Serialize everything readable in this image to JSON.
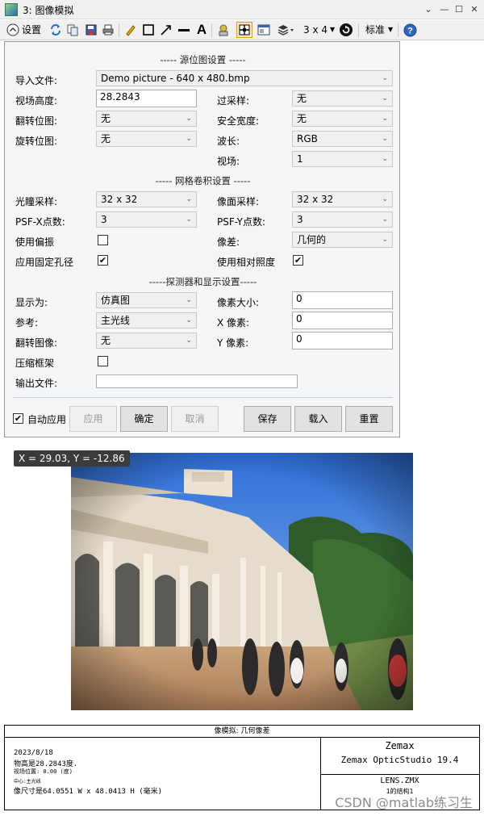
{
  "window": {
    "title": "3: 图像模拟",
    "minimize": "—",
    "restore": "☐",
    "close": "✕"
  },
  "toolbar": {
    "settings_label": "设置",
    "layout_label": "3 x 4",
    "standard_label": "标准"
  },
  "panel": {
    "source_header": "----- 源位图设置 -----",
    "import_file_label": "导入文件:",
    "import_file_value": "Demo picture -  640 x 480.bmp",
    "field_height_label": "视场高度:",
    "field_height_value": "28.2843",
    "oversample_label": "过采样:",
    "oversample_value": "无",
    "flip_source_label": "翻转位图:",
    "flip_source_value": "无",
    "guard_band_label": "安全宽度:",
    "guard_band_value": "无",
    "rotate_label": "旋转位图:",
    "rotate_value": "无",
    "wavelength_label": "波长:",
    "wavelength_value": "RGB",
    "field_label": "视场:",
    "field_value": "1",
    "psf_header": "----- 网格卷积设置 -----",
    "pupil_label": "光瞳采样:",
    "pupil_value": "32 x 32",
    "image_sampling_label": "像面采样:",
    "image_sampling_value": "32 x 32",
    "psfx_label": "PSF-X点数:",
    "psfx_value": "3",
    "psfy_label": "PSF-Y点数:",
    "psfy_value": "3",
    "polarization_label": "使用偏振",
    "polarization_checked": false,
    "aberrations_label": "像差:",
    "aberrations_value": "几何的",
    "fixed_aperture_label": "应用固定孔径",
    "fixed_aperture_checked": true,
    "relative_illum_label": "使用相对照度",
    "relative_illum_checked": true,
    "detector_header": "-----探测器和显示设置-----",
    "show_as_label": "显示为:",
    "show_as_value": "仿真图",
    "pixel_size_label": "像素大小:",
    "pixel_size_value": "0",
    "reference_label": "参考:",
    "reference_value": "主光线",
    "x_pixels_label": "X 像素:",
    "x_pixels_value": "0",
    "flip_image_label": "翻转图像:",
    "flip_image_value": "无",
    "y_pixels_label": "Y 像素:",
    "y_pixels_value": "0",
    "suppress_frame_label": "压缩框架",
    "suppress_frame_checked": false,
    "output_file_label": "输出文件:",
    "output_file_value": "",
    "auto_apply_label": "自动应用",
    "auto_apply_checked": true,
    "apply_button": "应用",
    "ok_button": "确定",
    "cancel_button": "取消",
    "save_button": "保存",
    "load_button": "载入",
    "reset_button": "重置"
  },
  "image": {
    "coordinate_readout": "X = 29.03, Y = -12.86"
  },
  "footer": {
    "caption": "像模拟: 几何像差",
    "date": "2023/8/18",
    "object_height": "物高是28.2843度.",
    "field_position": "视场位置: 0.00 (度)",
    "center": "中心:主光线",
    "image_size": "像尺寸是64.0551 W x 48.0413 H (毫米)",
    "brand": "Zemax",
    "product": "Zemax OpticStudio 19.4",
    "lens_file": "LENS.ZMX",
    "configuration": "1的结构1"
  },
  "watermark": "CSDN @matlab练习生"
}
